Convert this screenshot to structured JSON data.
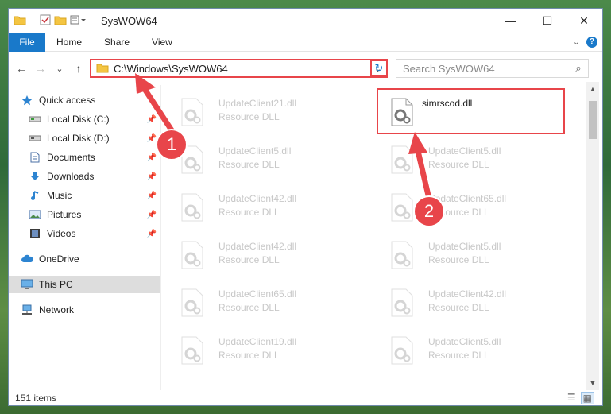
{
  "window": {
    "title": "SysWOW64",
    "controls": {
      "minimize": "—",
      "maximize": "☐",
      "close": "✕"
    }
  },
  "ribbon": {
    "tabs": [
      "File",
      "Home",
      "Share",
      "View"
    ],
    "help": "?",
    "accent": "#1979ca"
  },
  "navigation": {
    "back": "←",
    "forward": "→",
    "recent": "⌄",
    "up": "↑",
    "address": "C:\\Windows\\SysWOW64",
    "search_placeholder": "Search SysWOW64"
  },
  "sidebar": {
    "items": [
      {
        "label": "Quick access",
        "icon": "star-icon",
        "pinned": false
      },
      {
        "label": "Local Disk (C:)",
        "icon": "drive-icon",
        "pinned": true
      },
      {
        "label": "Local Disk (D:)",
        "icon": "drive-icon",
        "pinned": true
      },
      {
        "label": "Documents",
        "icon": "documents-icon",
        "pinned": true
      },
      {
        "label": "Downloads",
        "icon": "downloads-icon",
        "pinned": true
      },
      {
        "label": "Music",
        "icon": "music-icon",
        "pinned": true
      },
      {
        "label": "Pictures",
        "icon": "pictures-icon",
        "pinned": true
      },
      {
        "label": "Videos",
        "icon": "videos-icon",
        "pinned": true
      },
      {
        "label": "OneDrive",
        "icon": "cloud-icon",
        "pinned": false
      },
      {
        "label": "This PC",
        "icon": "computer-icon",
        "pinned": false,
        "selected": true
      },
      {
        "label": "Network",
        "icon": "network-icon",
        "pinned": false
      }
    ]
  },
  "files": [
    {
      "name": "UpdateClient21.dll",
      "type": "Resource DLL",
      "faded": true
    },
    {
      "name": "simrscod.dll",
      "type": "",
      "faded": false
    },
    {
      "name": "UpdateClient5.dll",
      "type": "Resource DLL",
      "faded": true
    },
    {
      "name": "UpdateClient5.dll",
      "type": "Resource DLL",
      "faded": true
    },
    {
      "name": "UpdateClient42.dll",
      "type": "Resource DLL",
      "faded": true
    },
    {
      "name": "UpdateClient65.dll",
      "type": "Resource DLL",
      "faded": true
    },
    {
      "name": "UpdateClient42.dll",
      "type": "Resource DLL",
      "faded": true
    },
    {
      "name": "UpdateClient5.dll",
      "type": "Resource DLL",
      "faded": true
    },
    {
      "name": "UpdateClient65.dll",
      "type": "Resource DLL",
      "faded": true
    },
    {
      "name": "UpdateClient42.dll",
      "type": "Resource DLL",
      "faded": true
    },
    {
      "name": "UpdateClient19.dll",
      "type": "Resource DLL",
      "faded": true
    },
    {
      "name": "UpdateClient5.dll",
      "type": "Resource DLL",
      "faded": true
    }
  ],
  "status": {
    "count": "151 items"
  },
  "annotations": {
    "badge1": "1",
    "badge2": "2",
    "color": "#e8454a"
  }
}
